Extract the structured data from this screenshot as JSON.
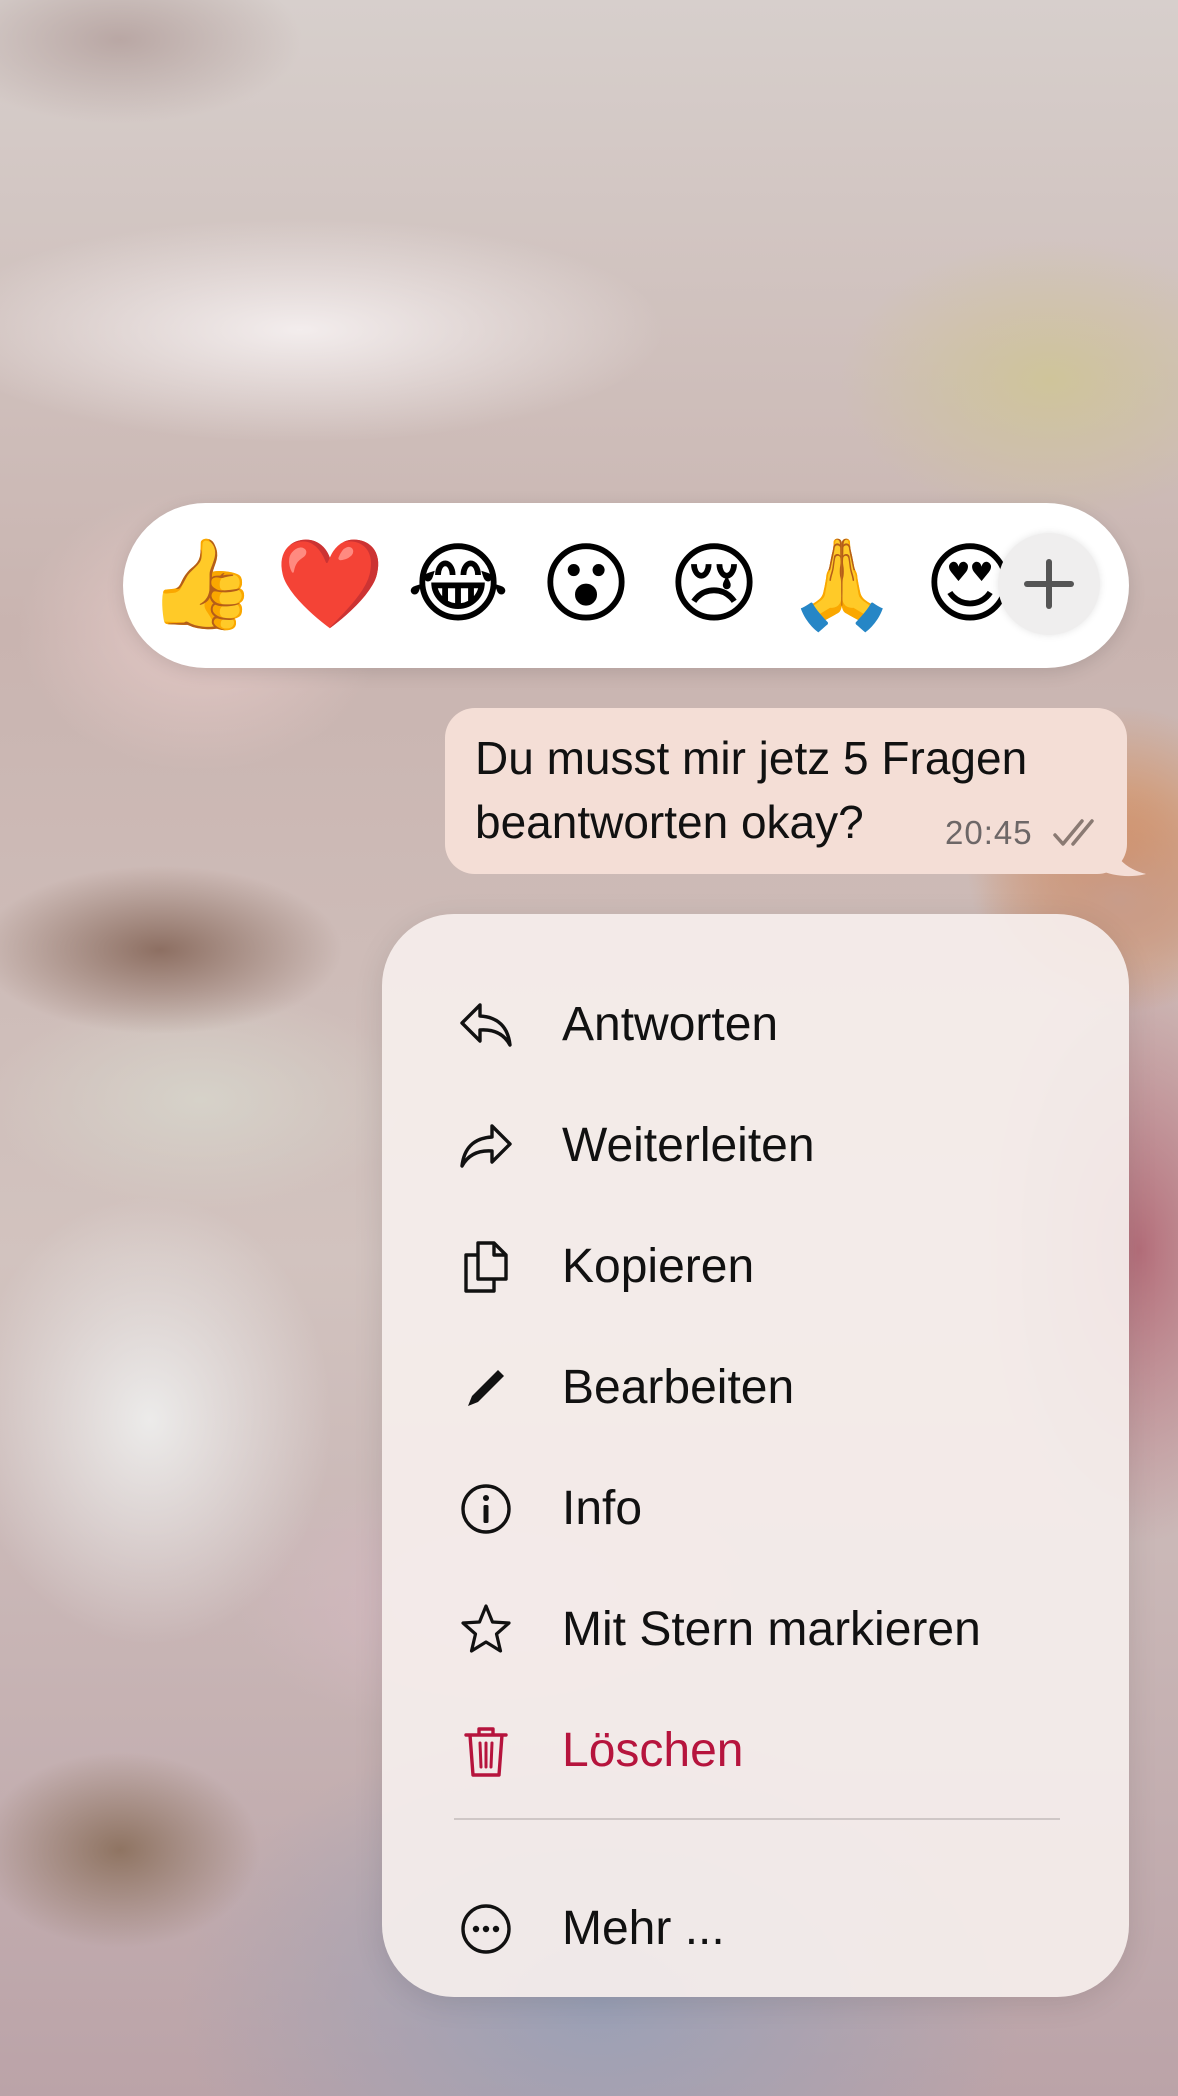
{
  "reactions": {
    "emojis": [
      "👍",
      "❤️",
      "😂",
      "😮",
      "😢",
      "🙏",
      "😍"
    ],
    "add_icon": "plus-icon"
  },
  "message": {
    "text": "Du musst mir jetz 5 Fragen beantworten okay?",
    "time": "20:45",
    "status_icon": "double-check-icon",
    "bubble_color": "#f4ded6"
  },
  "menu": {
    "items": [
      {
        "label": "Antworten",
        "icon": "reply-icon"
      },
      {
        "label": "Weiterleiten",
        "icon": "forward-icon"
      },
      {
        "label": "Kopieren",
        "icon": "copy-icon"
      },
      {
        "label": "Bearbeiten",
        "icon": "pencil-icon"
      },
      {
        "label": "Info",
        "icon": "info-icon"
      },
      {
        "label": "Mit Stern markieren",
        "icon": "star-icon"
      },
      {
        "label": "Löschen",
        "icon": "trash-icon",
        "color": "#b6143d"
      }
    ],
    "more": {
      "label": "Mehr ...",
      "icon": "more-icon"
    }
  }
}
